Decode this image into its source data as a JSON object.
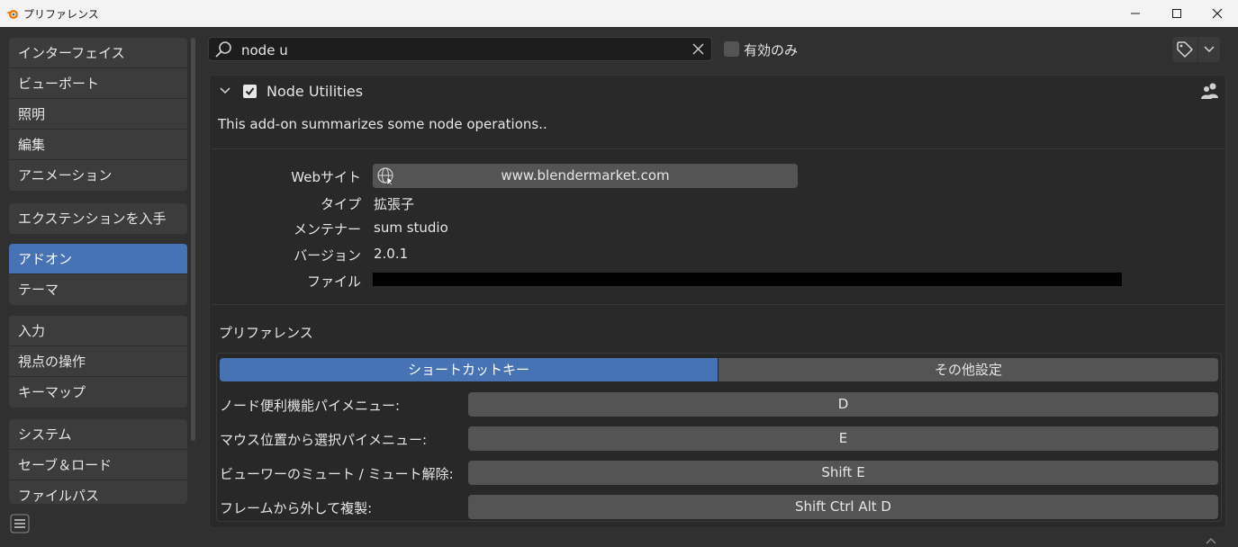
{
  "window": {
    "title": "プリファレンス"
  },
  "sidebar": {
    "groups": [
      {
        "items": [
          {
            "label": "インターフェイス"
          },
          {
            "label": "ビューポート"
          },
          {
            "label": "照明"
          },
          {
            "label": "編集"
          },
          {
            "label": "アニメーション"
          }
        ]
      },
      {
        "items": [
          {
            "label": "エクステンションを入手"
          }
        ]
      },
      {
        "items": [
          {
            "label": "アドオン",
            "active": true
          },
          {
            "label": "テーマ"
          }
        ]
      },
      {
        "items": [
          {
            "label": "入力"
          },
          {
            "label": "視点の操作"
          },
          {
            "label": "キーマップ"
          }
        ]
      },
      {
        "items": [
          {
            "label": "システム"
          },
          {
            "label": "セーブ＆ロード"
          },
          {
            "label": "ファイルパス"
          }
        ]
      }
    ]
  },
  "search": {
    "value": "node u"
  },
  "filter": {
    "enabled_only_label": "有効のみ",
    "enabled_only_checked": false
  },
  "addon": {
    "name": "Node Utilities",
    "enabled": true,
    "description": "This add-on summarizes some node operations..",
    "info": {
      "website_label": "Webサイト",
      "website_value": "www.blendermarket.com",
      "type_label": "タイプ",
      "type_value": "拡張子",
      "maintainer_label": "メンテナー",
      "maintainer_value": "sum studio",
      "version_label": "バージョン",
      "version_value": "2.0.1",
      "file_label": "ファイル"
    },
    "preferences": {
      "title": "プリファレンス",
      "tabs": [
        {
          "label": "ショートカットキー",
          "active": true
        },
        {
          "label": "その他設定",
          "active": false
        }
      ],
      "shortcuts": [
        {
          "label": "ノード便利機能パイメニュー:",
          "key": "D"
        },
        {
          "label": "マウス位置から選択パイメニュー:",
          "key": "E"
        },
        {
          "label": "ビューワーのミュート / ミュート解除:",
          "key": "Shift E"
        },
        {
          "label": "フレームから外して複製:",
          "key": "Shift Ctrl Alt D"
        }
      ]
    }
  },
  "colors": {
    "accent": "#4772b3",
    "background": "#303030",
    "panel": "#292929",
    "button": "#545454"
  }
}
